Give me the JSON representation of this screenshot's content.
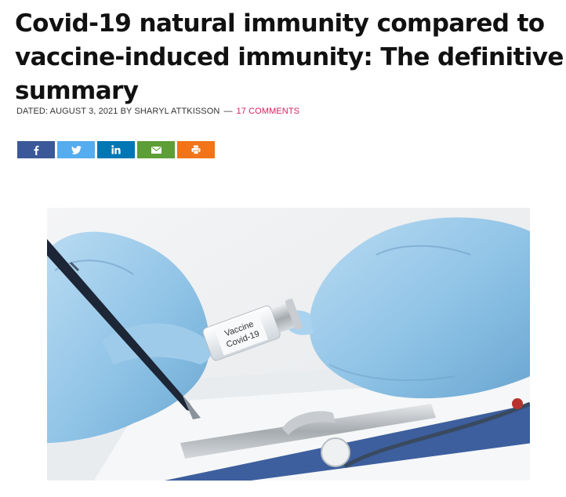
{
  "article": {
    "title": "Covid-19 natural immunity compared to vaccine-induced immunity: The definitive summary",
    "byline": {
      "dated_label": "DATED: AUGUST 3, 2021 BY SHARYL ATTKISSON",
      "separator": "—",
      "comments_link": "17 COMMENTS"
    }
  },
  "share_buttons": [
    {
      "network": "facebook",
      "icon": "facebook-icon",
      "color": "#3b5998"
    },
    {
      "network": "twitter",
      "icon": "twitter-icon",
      "color": "#55acee"
    },
    {
      "network": "linkedin",
      "icon": "linkedin-icon",
      "color": "#0077b5"
    },
    {
      "network": "email",
      "icon": "email-icon",
      "color": "#5d9e36"
    },
    {
      "network": "print",
      "icon": "print-icon",
      "color": "#f27418"
    }
  ],
  "hero_image": {
    "vial_label_line1": "Vaccine",
    "vial_label_line2": "Covid-19"
  },
  "colors": {
    "comments_accent": "#d6215b",
    "glove_blue": "#8fc3e6"
  }
}
